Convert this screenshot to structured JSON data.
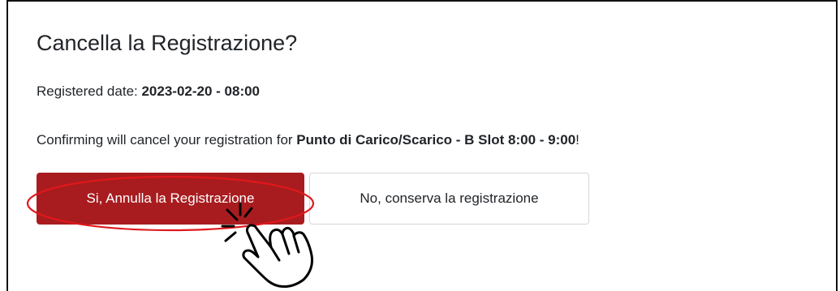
{
  "dialog": {
    "title": "Cancella la Registrazione?",
    "registered_label": "Registered date: ",
    "registered_value": "2023-02-20 - 08:00",
    "confirm_prefix": "Confirming will cancel your registration for ",
    "confirm_slot": "Punto di Carico/Scarico - B Slot 8:00 - 9:00",
    "confirm_suffix": "!"
  },
  "buttons": {
    "yes_label": "Si, Annulla la Registrazione",
    "no_label": "No, conserva la registrazione"
  },
  "annotation": {
    "highlight_color": "#e0181c",
    "cursor_icon": "hand-pointer-click-icon"
  },
  "colors": {
    "primary_button": "#a81c1f",
    "text": "#212529"
  }
}
